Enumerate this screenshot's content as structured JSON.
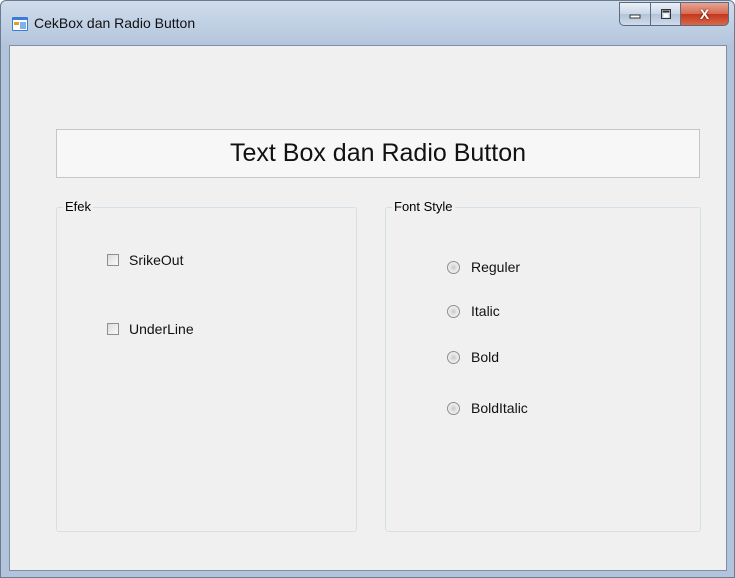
{
  "window": {
    "title": "CekBox dan Radio Button",
    "icon": "windows-form-icon"
  },
  "caption_buttons": {
    "minimize_icon": "minimize-icon",
    "maximize_icon": "maximize-icon",
    "close_label": "X"
  },
  "header": {
    "text": "Text Box dan Radio Button"
  },
  "effects_group": {
    "label": "Efek",
    "checkboxes": [
      {
        "label": "SrikeOut",
        "checked": false
      },
      {
        "label": "UnderLine",
        "checked": false
      }
    ]
  },
  "font_style_group": {
    "label": "Font Style",
    "radios": [
      {
        "label": "Reguler",
        "selected": false
      },
      {
        "label": "Italic",
        "selected": false
      },
      {
        "label": "Bold",
        "selected": false
      },
      {
        "label": "BoldItalic",
        "selected": false
      }
    ]
  }
}
